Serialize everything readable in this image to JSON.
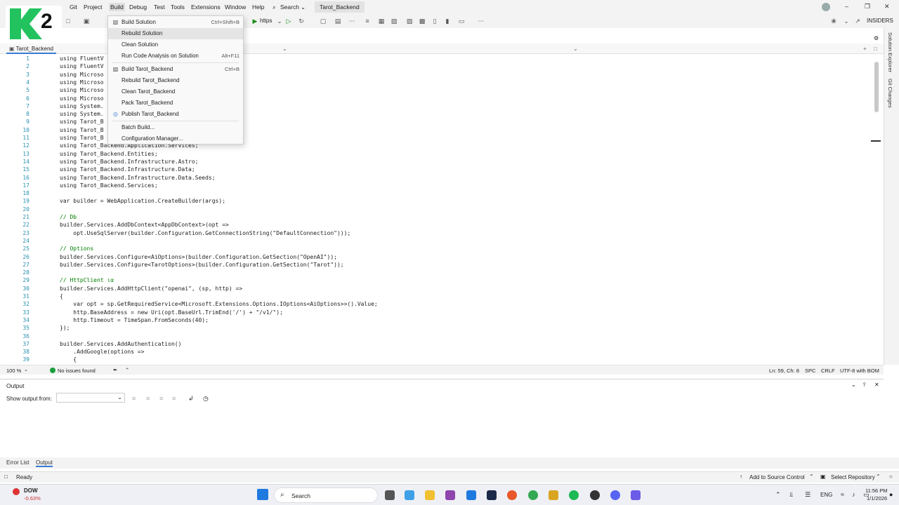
{
  "menubar": {
    "items": [
      "Git",
      "Project",
      "Build",
      "Debug",
      "Test",
      "Tools",
      "Extensions",
      "Window",
      "Help"
    ],
    "search_label": "Search",
    "title": "Tarot_Backend",
    "insiders": "INSIDERS"
  },
  "toolbar": {
    "run_label": "https"
  },
  "logo": {
    "text": "2"
  },
  "build_menu": {
    "items": [
      {
        "label": "Build Solution",
        "shortcut": "Ctrl+Shift+B"
      },
      {
        "label": "Rebuild Solution",
        "shortcut": ""
      },
      {
        "label": "Clean Solution",
        "shortcut": ""
      },
      {
        "label": "Run Code Analysis on Solution",
        "shortcut": "Alt+F11"
      },
      {
        "label": "Build Tarot_Backend",
        "shortcut": "Ctrl+B"
      },
      {
        "label": "Rebuild Tarot_Backend",
        "shortcut": ""
      },
      {
        "label": "Clean Tarot_Backend",
        "shortcut": ""
      },
      {
        "label": "Pack Tarot_Backend",
        "shortcut": ""
      },
      {
        "label": "Publish Tarot_Backend",
        "shortcut": ""
      },
      {
        "label": "Batch Build...",
        "shortcut": ""
      },
      {
        "label": "Configuration Manager...",
        "shortcut": ""
      }
    ]
  },
  "doc_tab": {
    "label": "Tarot_Backend"
  },
  "editor": {
    "lines": [
      {
        "n": "1",
        "t": "using FluentV"
      },
      {
        "n": "2",
        "t": "using FluentV"
      },
      {
        "n": "3",
        "t": "using Microso"
      },
      {
        "n": "4",
        "t": "using Microso"
      },
      {
        "n": "5",
        "t": "using Microso"
      },
      {
        "n": "6",
        "t": "using Microso"
      },
      {
        "n": "7",
        "t": "using System."
      },
      {
        "n": "8",
        "t": "using System."
      },
      {
        "n": "9",
        "t": "using Tarot_B"
      },
      {
        "n": "10",
        "t": "using Tarot_B"
      },
      {
        "n": "11",
        "t": "using Tarot_B"
      },
      {
        "n": "12",
        "t": "using Tarot_Backend.Application.Services;"
      },
      {
        "n": "13",
        "t": "using Tarot_Backend.Entities;"
      },
      {
        "n": "14",
        "t": "using Tarot_Backend.Infrastructure.Astro;"
      },
      {
        "n": "15",
        "t": "using Tarot_Backend.Infrastructure.Data;"
      },
      {
        "n": "16",
        "t": "using Tarot_Backend.Infrastructure.Data.Seeds;"
      },
      {
        "n": "17",
        "t": "using Tarot_Backend.Services;"
      },
      {
        "n": "18",
        "t": ""
      },
      {
        "n": "19",
        "t": "var builder = WebApplication.CreateBuilder(args);"
      },
      {
        "n": "20",
        "t": ""
      },
      {
        "n": "21",
        "t": "// Db"
      },
      {
        "n": "22",
        "t": "builder.Services.AddDbContext<AppDbContext>(opt =>"
      },
      {
        "n": "23",
        "t": "    opt.UseSqlServer(builder.Configuration.GetConnectionString(\"DefaultConnection\")));"
      },
      {
        "n": "24",
        "t": ""
      },
      {
        "n": "25",
        "t": "// Options"
      },
      {
        "n": "26",
        "t": "builder.Services.Configure<AiOptions>(builder.Configuration.GetSection(\"OpenAI\"));"
      },
      {
        "n": "27",
        "t": "builder.Services.Configure<TarotOptions>(builder.Configuration.GetSection(\"Tarot\"));"
      },
      {
        "n": "28",
        "t": ""
      },
      {
        "n": "29",
        "t": "// HttpClient ια"
      },
      {
        "n": "30",
        "t": "builder.Services.AddHttpClient(\"openai\", (sp, http) =>"
      },
      {
        "n": "31",
        "t": "{"
      },
      {
        "n": "32",
        "t": "    var opt = sp.GetRequiredService<Microsoft.Extensions.Options.IOptions<AiOptions>>().Value;"
      },
      {
        "n": "33",
        "t": "    http.BaseAddress = new Uri(opt.BaseUrl.TrimEnd('/') + \"/v1/\");"
      },
      {
        "n": "34",
        "t": "    http.Timeout = TimeSpan.FromSeconds(40);"
      },
      {
        "n": "35",
        "t": "});"
      },
      {
        "n": "36",
        "t": ""
      },
      {
        "n": "37",
        "t": "builder.Services.AddAuthentication()"
      },
      {
        "n": "38",
        "t": "    .AddGoogle(options =>"
      },
      {
        "n": "39",
        "t": "    {"
      }
    ]
  },
  "editor_status": {
    "zoom": "100 %",
    "issues": "No issues found",
    "position": "Ln: 59, Ch: 8",
    "spc": "SPC",
    "eol": "CRLF",
    "encoding": "UTF-8 with BOM"
  },
  "output": {
    "title": "Output",
    "show_from": "Show output from:"
  },
  "bottom_tabs": [
    "Error List",
    "Output"
  ],
  "statusbar": {
    "ready": "Ready",
    "source_control": "Add to Source Control",
    "repo": "Select Repository"
  },
  "taskbar": {
    "ticker": "DOW",
    "ticker_change": "-0.63%",
    "search": "Search",
    "lang": "ENG",
    "time": "11:56 PM",
    "date": "1/1/2026"
  },
  "right_tabs": [
    "Solution Explorer",
    "Git Changes"
  ],
  "colors": {
    "accent": "#3a7bd5",
    "logo_green": "#22c35e"
  }
}
